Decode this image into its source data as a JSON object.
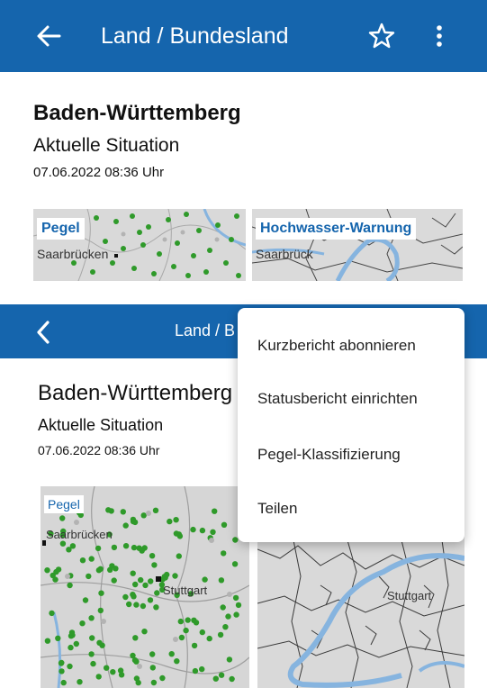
{
  "colors": {
    "brand": "#1565ad",
    "station_green": "#2f9a2a",
    "river_blue": "#86b4df"
  },
  "panel1": {
    "appbar": {
      "title": "Land / Bundesland",
      "back_icon": "arrow-left-icon",
      "favorite_icon": "star-outline-icon",
      "more_icon": "more-vertical-icon"
    },
    "heading": "Baden-Württemberg",
    "subheading": "Aktuelle Situation",
    "timestamp": "07.06.2022 08:36 Uhr",
    "tiles": [
      {
        "label": "Pegel",
        "map_label": "Saarbrücken"
      },
      {
        "label": "Hochwasser-Warnung",
        "map_label": "Saarbrück"
      }
    ]
  },
  "panel2": {
    "navbar": {
      "title": "Land / B",
      "back_icon": "chevron-left-icon"
    },
    "heading": "Baden-Württemberg",
    "subheading": "Aktuelle Situation",
    "timestamp": "07.06.2022 08:36 Uhr",
    "tiles": [
      {
        "label": "Pegel",
        "map_labels": [
          "Saarbrücken",
          "Stuttgart"
        ]
      },
      {
        "map_labels": [
          "Stuttgart"
        ]
      }
    ],
    "menu": {
      "items": [
        "Kurzbericht abonnieren",
        "Statusbericht einrichten",
        "Pegel-Klassifizierung",
        "Teilen"
      ]
    }
  }
}
